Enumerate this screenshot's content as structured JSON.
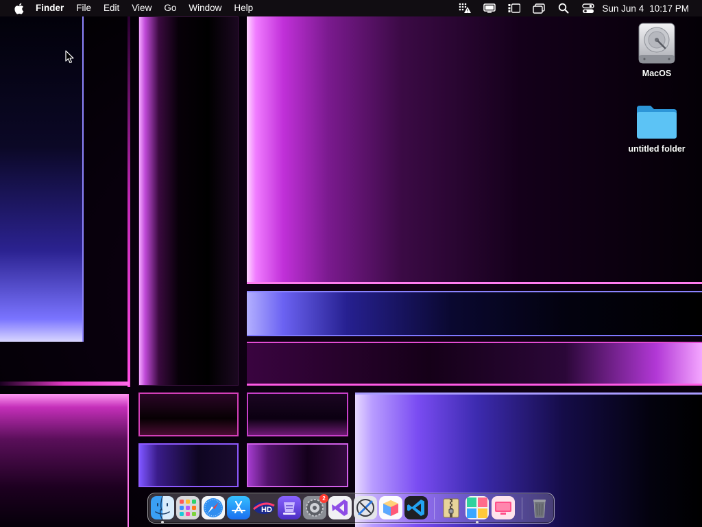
{
  "menubar": {
    "app_name": "Finder",
    "menus": [
      "File",
      "Edit",
      "View",
      "Go",
      "Window",
      "Help"
    ],
    "date": "Sun Jun 4",
    "time": "10:17 PM",
    "status_icons": [
      "network-warning-icon",
      "display-icon",
      "stage-manager-icon",
      "window-overlap-icon",
      "spotlight-search-icon",
      "control-center-icon"
    ]
  },
  "desktop": {
    "items": [
      {
        "label": "MacOS",
        "icon": "hard-drive-icon"
      },
      {
        "label": "untitled folder",
        "icon": "folder-icon"
      }
    ]
  },
  "dock": {
    "apps": [
      {
        "name": "Finder",
        "icon": "finder-icon",
        "running": true
      },
      {
        "name": "Launchpad",
        "icon": "launchpad-icon",
        "running": false
      },
      {
        "name": "Safari",
        "icon": "safari-icon",
        "running": false
      },
      {
        "name": "App Store",
        "icon": "app-store-icon",
        "running": false
      },
      {
        "name": "Video HD",
        "icon": "hd-video-icon",
        "running": false
      },
      {
        "name": "Archive Utility",
        "icon": "archive-icon",
        "running": false
      },
      {
        "name": "System Settings",
        "icon": "settings-gear-icon",
        "running": false,
        "badge": "2"
      },
      {
        "name": "Visual Studio",
        "icon": "visual-studio-icon",
        "running": false
      },
      {
        "name": "Xcode Instruments",
        "icon": "instruments-icon",
        "running": false
      },
      {
        "name": "Package App",
        "icon": "package-box-icon",
        "running": false
      },
      {
        "name": "VS Code",
        "icon": "vscode-icon",
        "running": false
      },
      {
        "name": "Archiver",
        "icon": "zip-archive-icon",
        "running": false
      },
      {
        "name": "Photo Grid",
        "icon": "photo-grid-icon",
        "running": true
      },
      {
        "name": "Screen Display",
        "icon": "pink-display-icon",
        "running": false
      },
      {
        "name": "Trash",
        "icon": "trash-icon",
        "running": false
      }
    ]
  },
  "colors": {
    "menubar_bg": "#120e14",
    "folder_blue": "#4fb8f0",
    "accent_magenta": "#ff5ae5",
    "accent_violet": "#8b84ff"
  }
}
